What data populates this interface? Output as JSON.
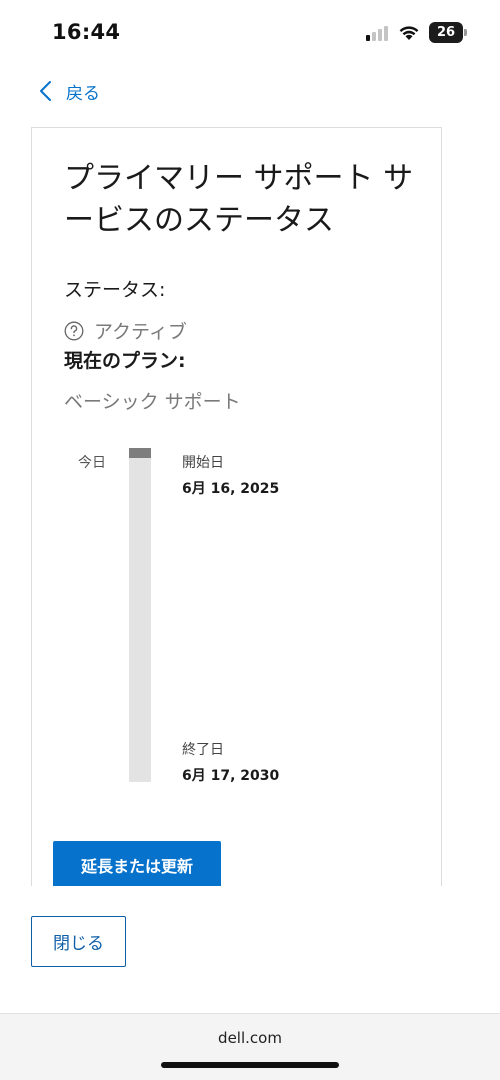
{
  "status_bar": {
    "time": "16:44",
    "battery_level": "26",
    "signal_bars_active": 1,
    "icons": [
      "signal-icon",
      "wifi-icon",
      "battery-icon"
    ]
  },
  "nav": {
    "back_label": "戻る",
    "back_icon": "chevron-left-icon"
  },
  "card": {
    "title": "プライマリー サポート サービスのステータス",
    "status_heading": "ステータス:",
    "status_icon": "question-circle-icon",
    "status_value": "アクティブ",
    "plan_heading": "現在のプラン:",
    "plan_value": "ベーシック サポート",
    "timeline": {
      "today_label": "今日",
      "start_label": "開始日",
      "start_date": "6月 16, 2025",
      "end_label": "終了日",
      "end_date": "6月 17, 2030"
    },
    "renew_button": "延長または更新"
  },
  "footer": {
    "close_button": "閉じる"
  },
  "browser": {
    "url": "dell.com"
  },
  "colors": {
    "accent": "#0672cb",
    "muted_text": "#7a7a7a",
    "track": "#e3e3e3",
    "marker": "#7d7d7d"
  }
}
